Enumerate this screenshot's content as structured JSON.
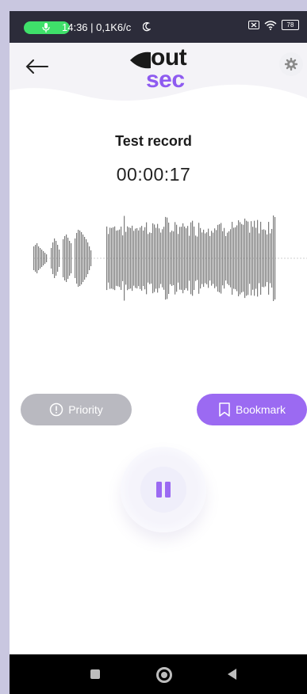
{
  "status": {
    "time_info": "14:36 | 0,1K6/c",
    "battery": "78"
  },
  "header": {
    "logo_top": "out",
    "logo_bottom": "sec"
  },
  "recording": {
    "title": "Test record",
    "timer": "00:00:17"
  },
  "actions": {
    "priority_label": "Priority",
    "bookmark_label": "Bookmark"
  },
  "colors": {
    "accent": "#9b6af2",
    "disabled": "#b9b9c0",
    "waveform": "#7b7b7b"
  },
  "icons": {
    "back": "back-arrow-icon",
    "settings": "gear-icon",
    "priority": "exclamation-circle-icon",
    "bookmark": "bookmark-icon",
    "pause": "pause-icon"
  }
}
